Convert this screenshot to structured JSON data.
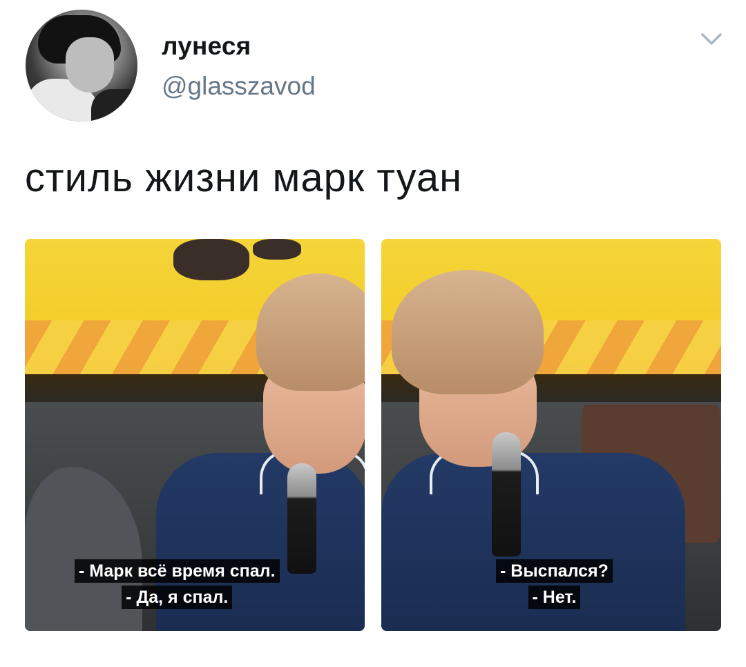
{
  "tweet": {
    "author": {
      "display_name": "лунеся",
      "handle": "@glasszavod",
      "avatar_icon": "avatar-photo"
    },
    "menu_icon": "chevron-down-icon",
    "text": "стиль жизни марк туан",
    "media": [
      {
        "subtitles": [
          "- Марк всё время спал.",
          "- Да, я спал."
        ]
      },
      {
        "subtitles": [
          "- Выспался?",
          "- Нет."
        ]
      }
    ]
  },
  "colors": {
    "text": "#14171a",
    "secondary": "#657786",
    "stage_yellow": "#f5d53a",
    "jacket_blue": "#233a66"
  }
}
